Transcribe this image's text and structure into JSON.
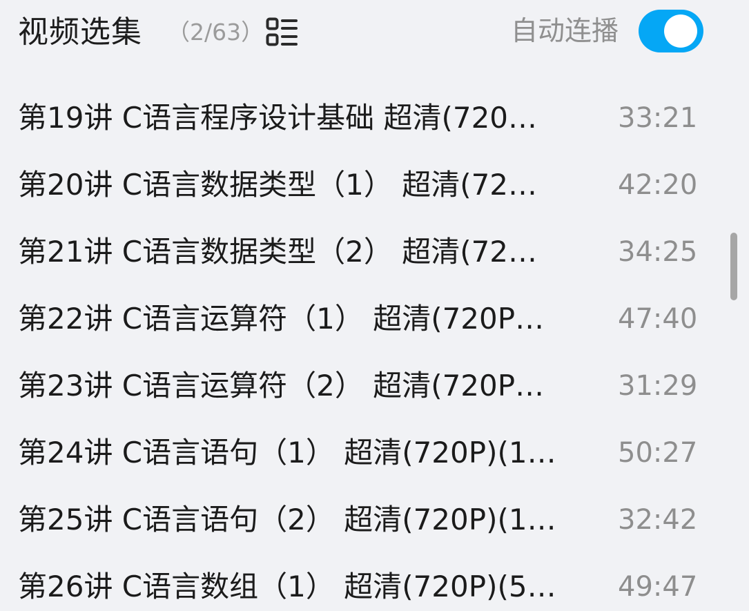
{
  "header": {
    "title": "视频选集",
    "count": "（2/63）",
    "autoplay_label": "自动连播",
    "toggle_on": true
  },
  "colors": {
    "accent": "#05a7f5",
    "background": "#f1f2f5",
    "secondary_text": "#8e8e8e"
  },
  "icons": {
    "list": "list-view-icon"
  },
  "episodes": [
    {
      "title": "第19讲 C语言程序设计基础 超清(720…",
      "duration": "33:21"
    },
    {
      "title": "第20讲 C语言数据类型（1） 超清(72…",
      "duration": "42:20"
    },
    {
      "title": "第21讲 C语言数据类型（2） 超清(72…",
      "duration": "34:25"
    },
    {
      "title": "第22讲 C语言运算符（1） 超清(720P…",
      "duration": "47:40"
    },
    {
      "title": "第23讲 C语言运算符（2） 超清(720P…",
      "duration": "31:29"
    },
    {
      "title": "第24讲 C语言语句（1） 超清(720P)(1…",
      "duration": "50:27"
    },
    {
      "title": "第25讲 C语言语句（2） 超清(720P)(1…",
      "duration": "32:42"
    },
    {
      "title": "第26讲 C语言数组（1） 超清(720P)(5…",
      "duration": "49:47"
    }
  ]
}
